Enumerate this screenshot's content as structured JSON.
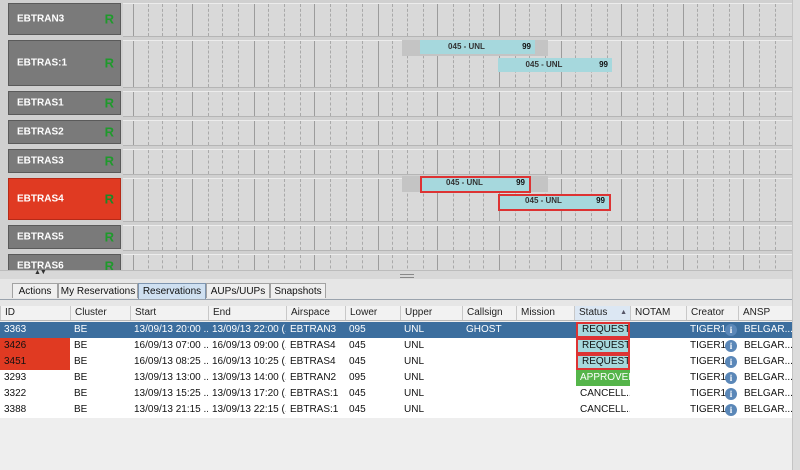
{
  "timeline": {
    "rows": [
      {
        "label": "EBTRAN3",
        "status": "R",
        "highlight": false
      },
      {
        "label": "EBTRAS:1",
        "status": "R",
        "highlight": false
      },
      {
        "label": "EBTRAS1",
        "status": "R",
        "highlight": false
      },
      {
        "label": "EBTRAS2",
        "status": "R",
        "highlight": false
      },
      {
        "label": "EBTRAS3",
        "status": "R",
        "highlight": false
      },
      {
        "label": "EBTRAS4",
        "status": "R",
        "highlight": true
      },
      {
        "label": "EBTRAS5",
        "status": "R",
        "highlight": false
      },
      {
        "label": "EBTRAS6",
        "status": "R",
        "highlight": false
      }
    ],
    "bars": [
      {
        "row": "EBTRAS:1",
        "text": "045 - UNL",
        "level": "99",
        "selected": false
      },
      {
        "row": "EBTRAS:1",
        "text": "045 - UNL",
        "level": "99",
        "selected": false
      },
      {
        "row": "EBTRAS4",
        "text": "045 - UNL",
        "level": "99",
        "selected": true
      },
      {
        "row": "EBTRAS4",
        "text": "045 - UNL",
        "level": "99",
        "selected": true
      }
    ]
  },
  "tabs": [
    {
      "label": "Actions",
      "active": false
    },
    {
      "label": "My Reservations",
      "active": false
    },
    {
      "label": "Reservations",
      "active": true
    },
    {
      "label": "AUPs/UUPs",
      "active": false
    },
    {
      "label": "Snapshots",
      "active": false
    }
  ],
  "table": {
    "columns": [
      "ID",
      "Cluster",
      "Start",
      "End",
      "Airspace",
      "Lower",
      "Upper",
      "Callsign",
      "Mission",
      "Status",
      "NOTAM",
      "Creator",
      "ANSP"
    ],
    "sorted_column": "Status",
    "sort_direction": "ascending",
    "rows": [
      {
        "id": "3363",
        "cluster": "BE",
        "start": "13/09/13 20:00 ...",
        "end": "13/09/13 22:00 (...",
        "airspace": "EBTRAN3",
        "lower": "095",
        "upper": "UNL",
        "callsign": "GHOST",
        "mission": "",
        "status": "REQUEST...",
        "notam": "",
        "creator": "TIGER1",
        "ansp": "BELGAR...",
        "selected": true,
        "flag": false,
        "status_style": "request"
      },
      {
        "id": "3426",
        "cluster": "BE",
        "start": "16/09/13 07:00 ...",
        "end": "16/09/13 09:00 (...",
        "airspace": "EBTRAS4",
        "lower": "045",
        "upper": "UNL",
        "callsign": "",
        "mission": "",
        "status": "REQUEST...",
        "notam": "",
        "creator": "TIGER1",
        "ansp": "BELGAR...",
        "selected": false,
        "flag": true,
        "status_style": "request"
      },
      {
        "id": "3451",
        "cluster": "BE",
        "start": "16/09/13 08:25 ...",
        "end": "16/09/13 10:25 (...",
        "airspace": "EBTRAS4",
        "lower": "045",
        "upper": "UNL",
        "callsign": "",
        "mission": "",
        "status": "REQUEST...",
        "notam": "",
        "creator": "TIGER1",
        "ansp": "BELGAR...",
        "selected": false,
        "flag": true,
        "status_style": "request"
      },
      {
        "id": "3293",
        "cluster": "BE",
        "start": "13/09/13 13:00 ...",
        "end": "13/09/13 14:00 (...",
        "airspace": "EBTRAN2",
        "lower": "095",
        "upper": "UNL",
        "callsign": "",
        "mission": "",
        "status": "APPROVED",
        "notam": "",
        "creator": "TIGER1",
        "ansp": "BELGAR...",
        "selected": false,
        "flag": false,
        "status_style": "approved"
      },
      {
        "id": "3322",
        "cluster": "BE",
        "start": "13/09/13 15:25 ...",
        "end": "13/09/13 17:20 (...",
        "airspace": "EBTRAS:1",
        "lower": "045",
        "upper": "UNL",
        "callsign": "",
        "mission": "",
        "status": "CANCELL...",
        "notam": "",
        "creator": "TIGER1",
        "ansp": "BELGAR...",
        "selected": false,
        "flag": false,
        "status_style": "plain"
      },
      {
        "id": "3388",
        "cluster": "BE",
        "start": "13/09/13 21:15 ...",
        "end": "13/09/13 22:15 (...",
        "airspace": "EBTRAS:1",
        "lower": "045",
        "upper": "UNL",
        "callsign": "",
        "mission": "",
        "status": "CANCELL...",
        "notam": "",
        "creator": "TIGER1",
        "ansp": "BELGAR...",
        "selected": false,
        "flag": false,
        "status_style": "plain"
      }
    ]
  },
  "icons": {
    "info": "info-icon",
    "row_status": "R"
  },
  "colors": {
    "flag_red": "#e03a22",
    "approved_green": "#55b54a",
    "selected_row": "#3c6e9e",
    "bar_cyan": "#a6d8dd"
  }
}
